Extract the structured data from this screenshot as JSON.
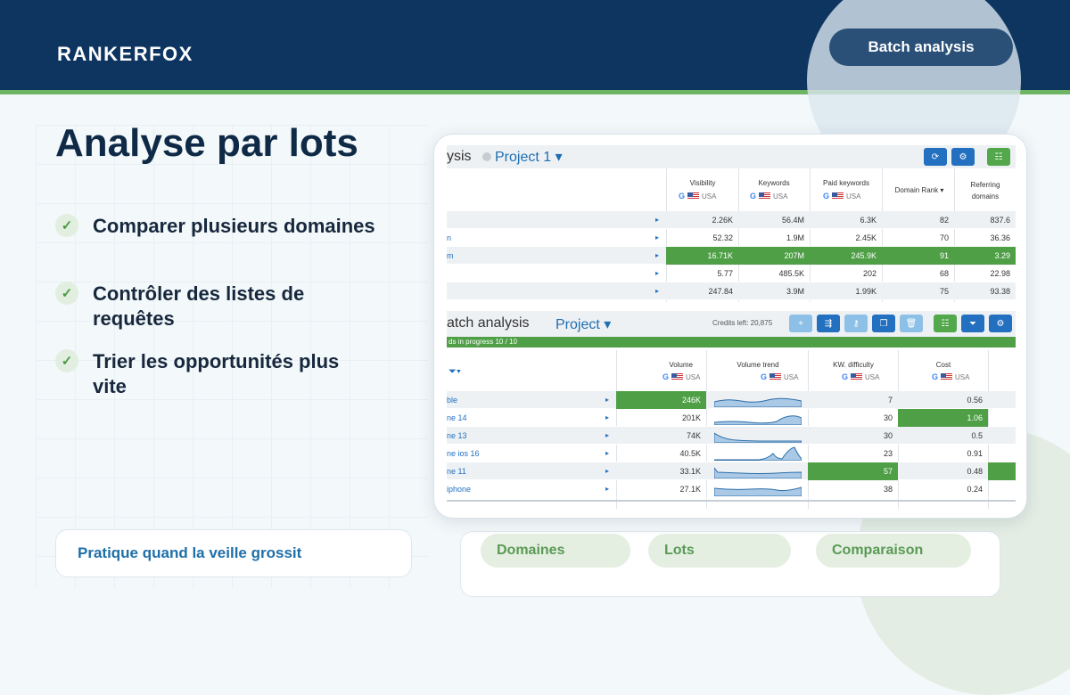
{
  "brand": "RANKERFOX",
  "header_button": "Batch analysis",
  "title": "Analyse par lots",
  "features": [
    "Comparer plusieurs domaines",
    "Contrôler des listes de requêtes",
    "Trier les opportunités plus vite"
  ],
  "note": "Pratique quand la veille grossit",
  "tags": [
    "Domaines",
    "Lots",
    "Comparaison"
  ],
  "colors": {
    "navy": "#0e3560",
    "green": "#6db463",
    "accent_blue": "#2370c0"
  },
  "top_panel": {
    "title_fragment": "ysis",
    "project": "Project 1 ▾",
    "headers": [
      "Visibility",
      "Keywords",
      "Paid keywords",
      "Domain Rank ▾",
      "Referring domains"
    ],
    "flag_label": "USA",
    "rows": [
      {
        "kw": "",
        "cells": [
          "2.26K",
          "56.4M",
          "6.3K",
          "82",
          "837.6"
        ]
      },
      {
        "kw": "n",
        "cells": [
          "52.32",
          "1.9M",
          "2.45K",
          "70",
          "36.36"
        ]
      },
      {
        "kw": "m",
        "cells": [
          "16.71K",
          "207M",
          "245.9K",
          "91",
          "3.29"
        ],
        "highlight": true
      },
      {
        "kw": "",
        "cells": [
          "5.77",
          "485.5K",
          "202",
          "68",
          "22.98"
        ]
      },
      {
        "kw": "",
        "cells": [
          "247.84",
          "3.9M",
          "1.99K",
          "75",
          "93.38"
        ]
      }
    ]
  },
  "bottom_panel": {
    "title_fragment": "atch analysis",
    "project": "Project ▾",
    "credits": "Credits left: 20,875",
    "progress": "ds in progress 10 / 10",
    "headers": [
      "Volume",
      "Volume trend",
      "KW. difficulty",
      "Cost"
    ],
    "flag_label": "USA",
    "rows": [
      {
        "kw": "ble",
        "volume": "246K",
        "kd": "7",
        "cost": "0.56",
        "hl": "volume"
      },
      {
        "kw": "ne 14",
        "volume": "201K",
        "kd": "30",
        "cost": "1.06",
        "hl": "cost"
      },
      {
        "kw": "ne 13",
        "volume": "74K",
        "kd": "30",
        "cost": "0.5",
        "hl": ""
      },
      {
        "kw": "ne ios 16",
        "volume": "40.5K",
        "kd": "23",
        "cost": "0.91",
        "hl": ""
      },
      {
        "kw": "ne 11",
        "volume": "33.1K",
        "kd": "57",
        "cost": "0.48",
        "hl": "kd"
      },
      {
        "kw": "iphone",
        "volume": "27.1K",
        "kd": "38",
        "cost": "0.24",
        "hl": ""
      }
    ]
  }
}
